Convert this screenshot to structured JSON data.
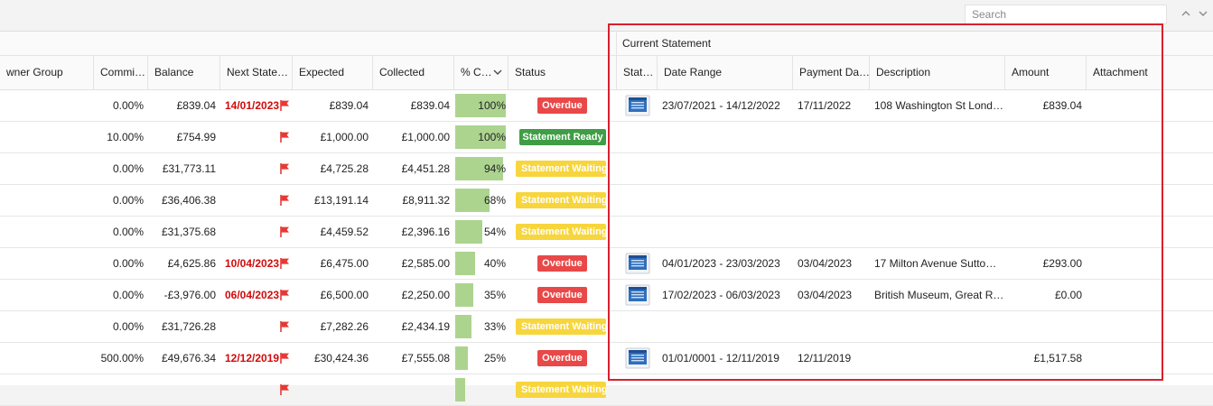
{
  "toolbar": {
    "search_placeholder": "Search"
  },
  "group_header": {
    "label": "Current Statement"
  },
  "columns": {
    "owner_group": "wner Group",
    "commission": "Commi…",
    "balance": "Balance",
    "next_statement": "Next State…",
    "expected": "Expected",
    "collected": "Collected",
    "percent": "% C…",
    "status": "Status",
    "stat": "Stat…",
    "date_range": "Date Range",
    "payment_date": "Payment Da…",
    "description": "Description",
    "amount": "Amount",
    "attachment": "Attachment"
  },
  "colors": {
    "overdue": "#e94848",
    "ready": "#3f9e45",
    "waiting": "#f7d53d",
    "progress": "#acd48f",
    "flag": "#e53935",
    "highlight": "#d9202d"
  },
  "rows": [
    {
      "commission": "0.00%",
      "balance": "£839.04",
      "next_date": "14/01/2023",
      "expected": "£839.04",
      "collected": "£839.04",
      "percent_label": "100%",
      "percent": 100,
      "status": "Overdue",
      "status_type": "overdue",
      "has_statement": true,
      "date_range": "23/07/2021 - 14/12/2022",
      "payment_date": "17/11/2022",
      "description": "108 Washington St Lond…",
      "amount": "£839.04"
    },
    {
      "commission": "10.00%",
      "balance": "£754.99",
      "next_date": "",
      "expected": "£1,000.00",
      "collected": "£1,000.00",
      "percent_label": "100%",
      "percent": 100,
      "status": "Statement Ready",
      "status_type": "ready",
      "has_statement": false,
      "date_range": "",
      "payment_date": "",
      "description": "",
      "amount": ""
    },
    {
      "commission": "0.00%",
      "balance": "£31,773.11",
      "next_date": "",
      "expected": "£4,725.28",
      "collected": "£4,451.28",
      "percent_label": "94%",
      "percent": 94,
      "status": "Statement Waiting",
      "status_type": "waiting",
      "has_statement": false,
      "date_range": "",
      "payment_date": "",
      "description": "",
      "amount": ""
    },
    {
      "commission": "0.00%",
      "balance": "£36,406.38",
      "next_date": "",
      "expected": "£13,191.14",
      "collected": "£8,911.32",
      "percent_label": "68%",
      "percent": 68,
      "status": "Statement Waiting",
      "status_type": "waiting",
      "has_statement": false,
      "date_range": "",
      "payment_date": "",
      "description": "",
      "amount": ""
    },
    {
      "commission": "0.00%",
      "balance": "£31,375.68",
      "next_date": "",
      "expected": "£4,459.52",
      "collected": "£2,396.16",
      "percent_label": "54%",
      "percent": 54,
      "status": "Statement Waiting",
      "status_type": "waiting",
      "has_statement": false,
      "date_range": "",
      "payment_date": "",
      "description": "",
      "amount": ""
    },
    {
      "commission": "0.00%",
      "balance": "£4,625.86",
      "next_date": "10/04/2023",
      "expected": "£6,475.00",
      "collected": "£2,585.00",
      "percent_label": "40%",
      "percent": 40,
      "status": "Overdue",
      "status_type": "overdue",
      "has_statement": true,
      "date_range": "04/01/2023 - 23/03/2023",
      "payment_date": "03/04/2023",
      "description": "17 Milton Avenue Sutto…",
      "amount": "£293.00"
    },
    {
      "commission": "0.00%",
      "balance": "-£3,976.00",
      "next_date": "06/04/2023",
      "expected": "£6,500.00",
      "collected": "£2,250.00",
      "percent_label": "35%",
      "percent": 35,
      "status": "Overdue",
      "status_type": "overdue",
      "has_statement": true,
      "date_range": "17/02/2023 - 06/03/2023",
      "payment_date": "03/04/2023",
      "description": "British Museum, Great R…",
      "amount": "£0.00"
    },
    {
      "commission": "0.00%",
      "balance": "£31,726.28",
      "next_date": "",
      "expected": "£7,282.26",
      "collected": "£2,434.19",
      "percent_label": "33%",
      "percent": 33,
      "status": "Statement Waiting",
      "status_type": "waiting",
      "has_statement": false,
      "date_range": "",
      "payment_date": "",
      "description": "",
      "amount": ""
    },
    {
      "commission": "500.00%",
      "balance": "£49,676.34",
      "next_date": "12/12/2019",
      "expected": "£30,424.36",
      "collected": "£7,555.08",
      "percent_label": "25%",
      "percent": 25,
      "status": "Overdue",
      "status_type": "overdue",
      "has_statement": true,
      "date_range": "01/01/0001 - 12/11/2019",
      "payment_date": "12/11/2019",
      "description": "",
      "amount": "£1,517.58"
    },
    {
      "commission": "",
      "balance": "",
      "next_date": "",
      "expected": "",
      "collected": "",
      "percent_label": "",
      "percent": 20,
      "status": "Statement Waiting",
      "status_type": "waiting",
      "has_statement": false,
      "date_range": "",
      "payment_date": "",
      "description": "",
      "amount": ""
    }
  ]
}
